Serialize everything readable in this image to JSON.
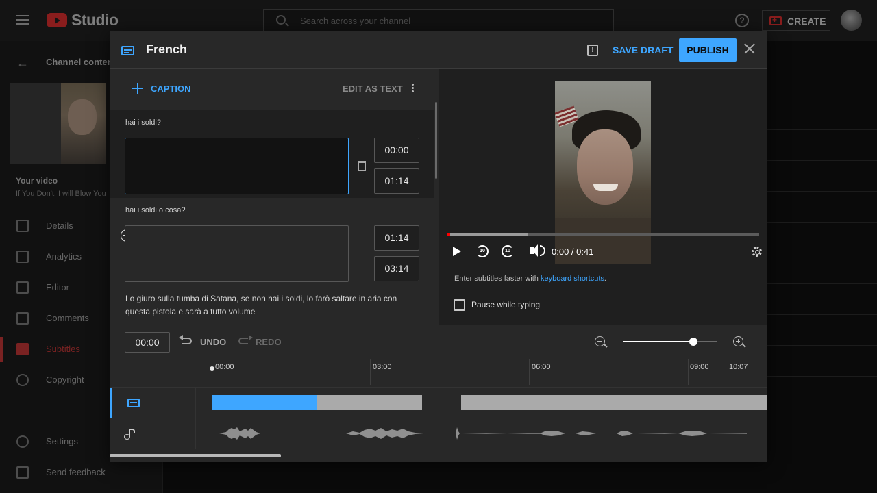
{
  "app": {
    "studio_label": "Studio",
    "search_placeholder": "Search across your channel",
    "create_label": "CREATE"
  },
  "sidebar": {
    "channel_content": "Channel content",
    "your_video": "Your video",
    "video_title": "If You Don't, I will Blow You",
    "items": [
      {
        "label": "Details",
        "icon": "pencil-icon"
      },
      {
        "label": "Analytics",
        "icon": "analytics-icon"
      },
      {
        "label": "Editor",
        "icon": "editor-icon"
      },
      {
        "label": "Comments",
        "icon": "comments-icon"
      },
      {
        "label": "Subtitles",
        "icon": "subtitles-icon",
        "active": true
      },
      {
        "label": "Copyright",
        "icon": "copyright-icon"
      },
      {
        "label": "Settings",
        "icon": "gear-icon"
      },
      {
        "label": "Send feedback",
        "icon": "feedback-icon"
      }
    ]
  },
  "dialog": {
    "title": "French",
    "save_draft": "SAVE DRAFT",
    "publish": "PUBLISH"
  },
  "editor": {
    "caption_button": "CAPTION",
    "edit_as_text": "EDIT AS TEXT",
    "cues": [
      {
        "source": "hai i soldi?",
        "text": "",
        "start": "00:00",
        "end": "01:14"
      },
      {
        "source": "hai i soldi o cosa?",
        "text": "",
        "start": "01:14",
        "end": "03:14"
      }
    ],
    "next_source": "Lo giuro sulla tumba di Satana, se non hai i soldi, lo farò saltare in aria con questa pistola e sarà a tutto volume"
  },
  "preview": {
    "time_display": "0:00 / 0:41",
    "progress_fraction": 0.0,
    "seek_back_label": "10",
    "seek_forward_label": "10",
    "shortcut_prefix": "Enter subtitles faster with ",
    "shortcut_link": "keyboard shortcuts",
    "shortcut_suffix": ".",
    "pause_while_typing": "Pause while typing",
    "pause_checked": false
  },
  "timeline": {
    "current_time": "00:00",
    "undo": "UNDO",
    "redo": "REDO",
    "zoom_level": 0.75,
    "ticks": [
      "00:00",
      "03:00",
      "06:00",
      "09:00",
      "10:07"
    ]
  },
  "colors": {
    "accent": "#3ea6ff",
    "dialog_bg": "#282828",
    "brand_red": "#ff0000"
  }
}
